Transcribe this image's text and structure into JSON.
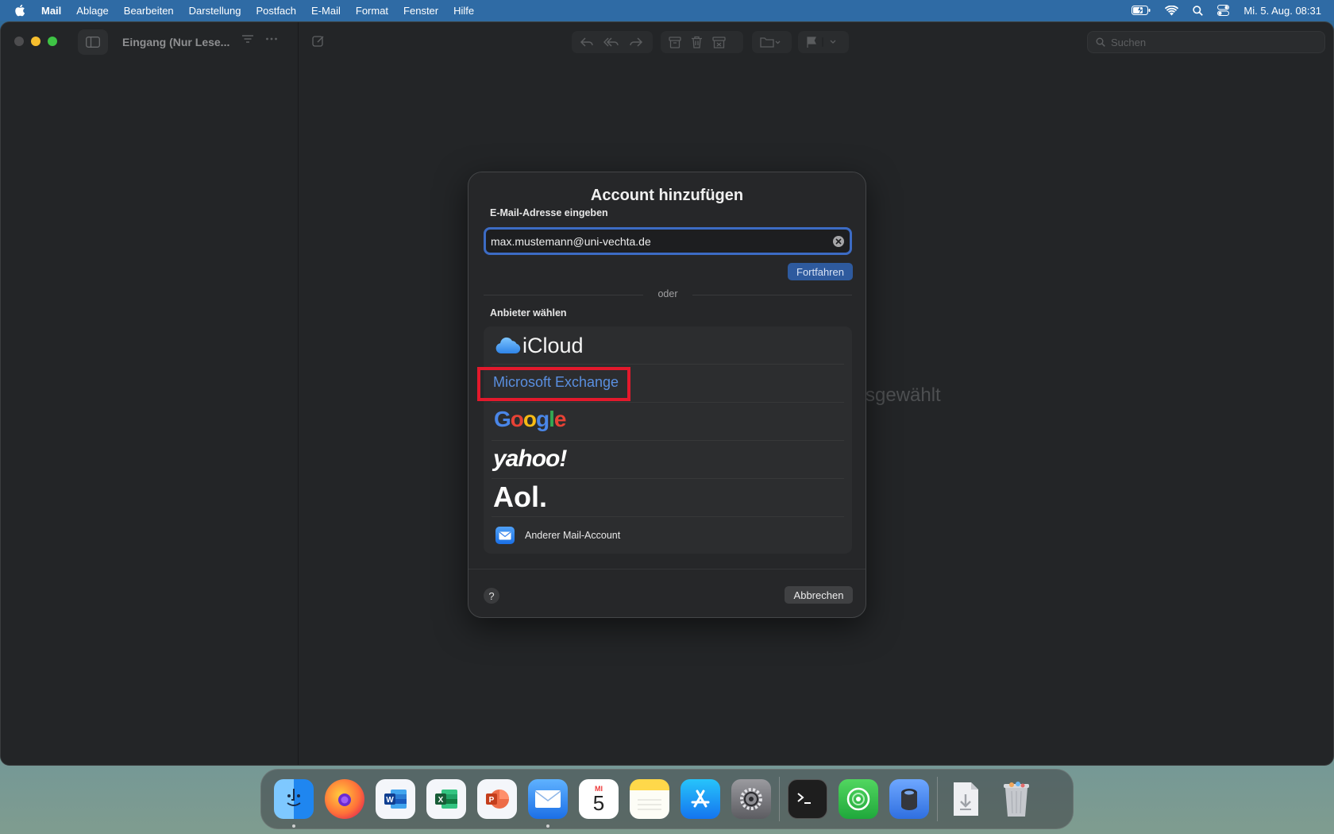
{
  "menubar": {
    "app": "Mail",
    "items": [
      "Ablage",
      "Bearbeiten",
      "Darstellung",
      "Postfach",
      "E-Mail",
      "Format",
      "Fenster",
      "Hilfe"
    ],
    "datetime": "Mi. 5. Aug. 08:31"
  },
  "window": {
    "mailbox_title": "Eingang (Nur Lese...",
    "search_placeholder": "Suchen",
    "empty_state_fragment": "sgewählt"
  },
  "dialog": {
    "title": "Account hinzufügen",
    "email_label": "E-Mail-Adresse eingeben",
    "email_value": "max.mustemann@uni-vechta.de",
    "continue_label": "Fortfahren",
    "or_label": "oder",
    "provider_label": "Anbieter wählen",
    "providers": {
      "icloud": "iCloud",
      "exchange": "Microsoft Exchange",
      "google": "Google",
      "yahoo": "yahoo!",
      "aol": "Aol.",
      "other": "Anderer Mail-Account"
    },
    "help_label": "?",
    "cancel_label": "Abbrechen"
  },
  "dock": {
    "apps": [
      "finder",
      "firefox",
      "word",
      "excel",
      "powerpoint",
      "mail",
      "calendar",
      "notes",
      "app-store",
      "system-settings",
      "terminal",
      "find-my",
      "disk-utility",
      "downloads",
      "trash"
    ],
    "calendar_month": "MI",
    "calendar_day": "5"
  },
  "colors": {
    "accent": "#3c6bc4",
    "highlight": "#e3192c",
    "exchange_text": "#5a8fe0"
  }
}
